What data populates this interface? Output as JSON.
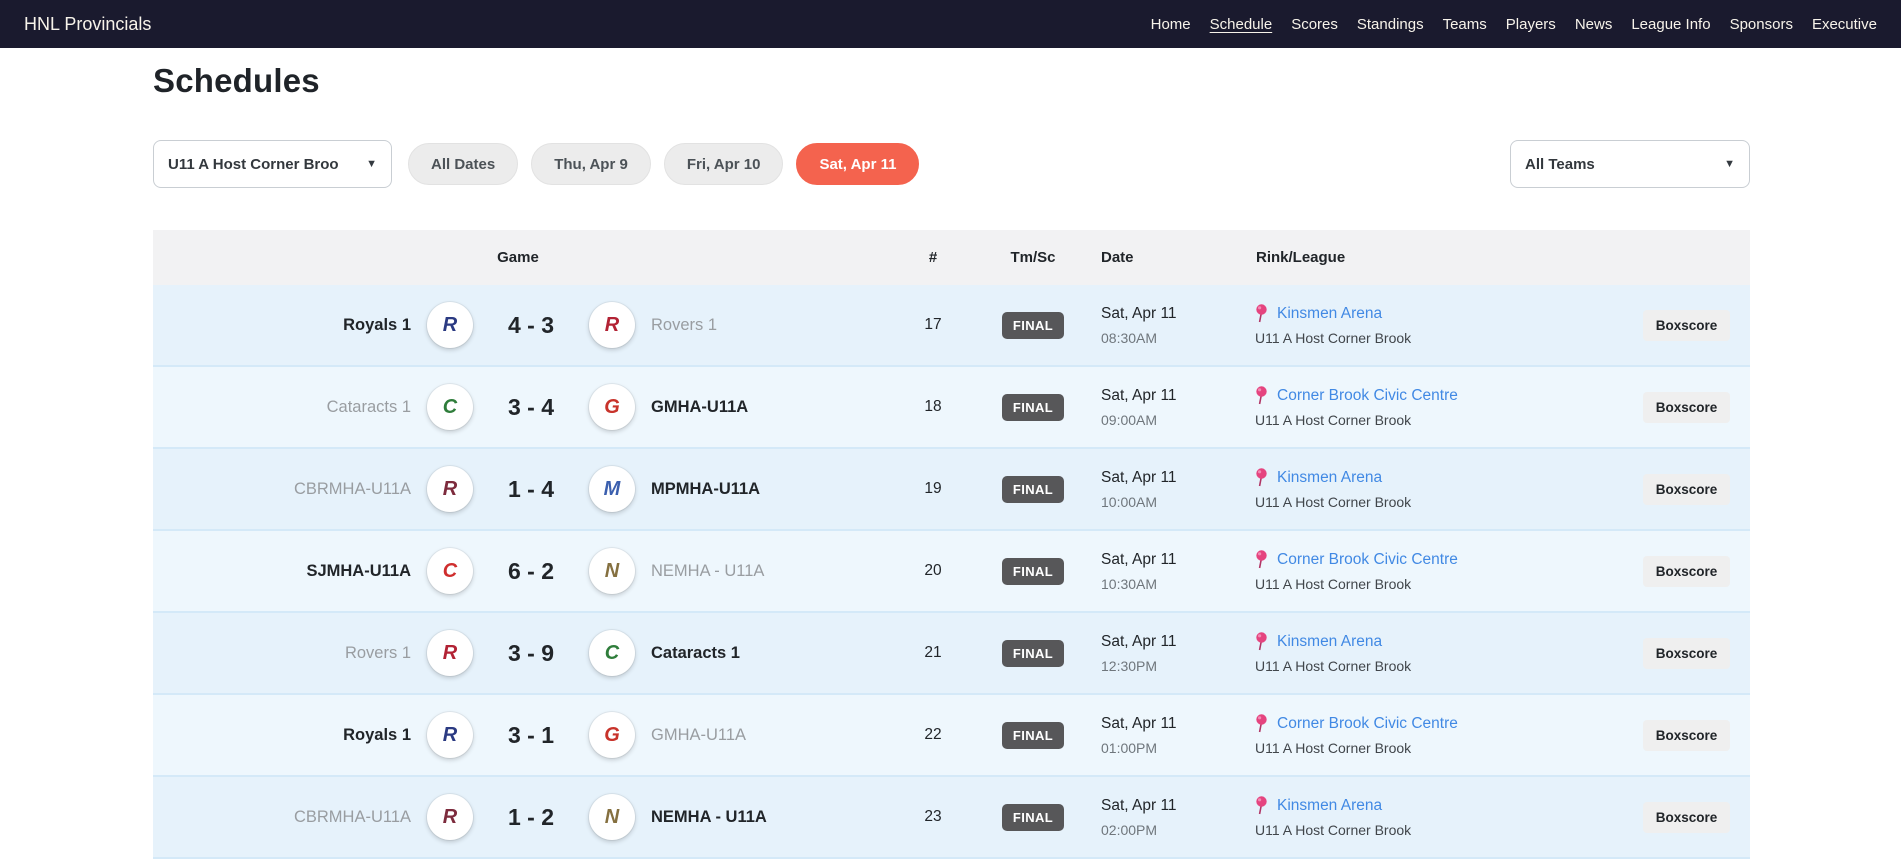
{
  "navbar": {
    "brand": "HNL Provincials",
    "items": [
      {
        "label": "Home",
        "active": false
      },
      {
        "label": "Schedule",
        "active": true
      },
      {
        "label": "Scores",
        "active": false
      },
      {
        "label": "Standings",
        "active": false
      },
      {
        "label": "Teams",
        "active": false
      },
      {
        "label": "Players",
        "active": false
      },
      {
        "label": "News",
        "active": false
      },
      {
        "label": "League Info",
        "active": false
      },
      {
        "label": "Sponsors",
        "active": false
      },
      {
        "label": "Executive",
        "active": false
      }
    ]
  },
  "page": {
    "title": "Schedules"
  },
  "filters": {
    "division_dropdown": {
      "value": "U11 A Host Corner Broo"
    },
    "date_pills": [
      {
        "label": "All Dates",
        "active": false
      },
      {
        "label": "Thu, Apr 9",
        "active": false
      },
      {
        "label": "Fri, Apr 10",
        "active": false
      },
      {
        "label": "Sat, Apr 11",
        "active": true
      }
    ],
    "team_dropdown": {
      "value": "All Teams"
    },
    "active_pill_color": "#f4634e"
  },
  "table": {
    "headers": {
      "game": "Game",
      "number": "#",
      "tmsc": "Tm/Sc",
      "date": "Date",
      "rink": "Rink/League"
    },
    "boxscore_label": "Boxscore",
    "link_color": "#4189e4",
    "rows": [
      {
        "away": "Royals 1",
        "away_logo": {
          "letter": "R",
          "color": "#2b3a82"
        },
        "home": "Rovers 1",
        "home_logo": {
          "letter": "R",
          "color": "#b22234"
        },
        "score": "4 - 3",
        "winner": "away",
        "number": "17",
        "status": "FINAL",
        "date": "Sat, Apr 11",
        "time": "08:30AM",
        "rink": "Kinsmen Arena",
        "league": "U11 A Host Corner Brook"
      },
      {
        "away": "Cataracts 1",
        "away_logo": {
          "letter": "C",
          "color": "#2f7d3b"
        },
        "home": "GMHA-U11A",
        "home_logo": {
          "letter": "G",
          "color": "#c8332b"
        },
        "score": "3 - 4",
        "winner": "home",
        "number": "18",
        "status": "FINAL",
        "date": "Sat, Apr 11",
        "time": "09:00AM",
        "rink": "Corner Brook Civic Centre",
        "league": "U11 A Host Corner Brook"
      },
      {
        "away": "CBRMHA-U11A",
        "away_logo": {
          "letter": "R",
          "color": "#7d2b3d"
        },
        "home": "MPMHA-U11A",
        "home_logo": {
          "letter": "M",
          "color": "#3b5fae"
        },
        "score": "1 - 4",
        "winner": "home",
        "number": "19",
        "status": "FINAL",
        "date": "Sat, Apr 11",
        "time": "10:00AM",
        "rink": "Kinsmen Arena",
        "league": "U11 A Host Corner Brook"
      },
      {
        "away": "SJMHA-U11A",
        "away_logo": {
          "letter": "C",
          "color": "#cf2e2e"
        },
        "home": "NEMHA - U11A",
        "home_logo": {
          "letter": "N",
          "color": "#857040"
        },
        "score": "6 - 2",
        "winner": "away",
        "number": "20",
        "status": "FINAL",
        "date": "Sat, Apr 11",
        "time": "10:30AM",
        "rink": "Corner Brook Civic Centre",
        "league": "U11 A Host Corner Brook"
      },
      {
        "away": "Rovers 1",
        "away_logo": {
          "letter": "R",
          "color": "#b22234"
        },
        "home": "Cataracts 1",
        "home_logo": {
          "letter": "C",
          "color": "#2f7d3b"
        },
        "score": "3 - 9",
        "winner": "home",
        "number": "21",
        "status": "FINAL",
        "date": "Sat, Apr 11",
        "time": "12:30PM",
        "rink": "Kinsmen Arena",
        "league": "U11 A Host Corner Brook"
      },
      {
        "away": "Royals 1",
        "away_logo": {
          "letter": "R",
          "color": "#2b3a82"
        },
        "home": "GMHA-U11A",
        "home_logo": {
          "letter": "G",
          "color": "#c8332b"
        },
        "score": "3 - 1",
        "winner": "away",
        "number": "22",
        "status": "FINAL",
        "date": "Sat, Apr 11",
        "time": "01:00PM",
        "rink": "Corner Brook Civic Centre",
        "league": "U11 A Host Corner Brook"
      },
      {
        "away": "CBRMHA-U11A",
        "away_logo": {
          "letter": "R",
          "color": "#7d2b3d"
        },
        "home": "NEMHA - U11A",
        "home_logo": {
          "letter": "N",
          "color": "#857040"
        },
        "score": "1 - 2",
        "winner": "home",
        "number": "23",
        "status": "FINAL",
        "date": "Sat, Apr 11",
        "time": "02:00PM",
        "rink": "Kinsmen Arena",
        "league": "U11 A Host Corner Brook"
      }
    ]
  }
}
